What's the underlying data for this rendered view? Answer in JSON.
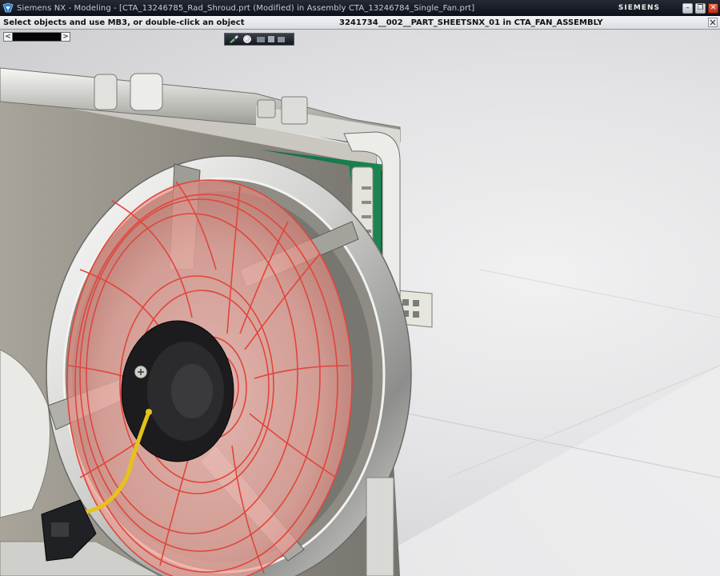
{
  "window": {
    "title": "Siemens NX - Modeling - [CTA_13246785_Rad_Shroud.prt (Modified)  in Assembly CTA_13246784_Single_Fan.prt]",
    "brand": "SIEMENS",
    "minimize_glyph": "–",
    "restore_glyph": "❐",
    "close_glyph": "✕"
  },
  "status_bar": {
    "prompt": "Select objects and use MB3, or double-click an object",
    "work_part": "3241734__002__PART_SHEETSNX_01 in CTA_FAN_ASSEMBLY"
  },
  "navigation": {
    "back_glyph": "<",
    "forward_glyph": ">"
  },
  "view_toolbar": {
    "tools": [
      "sketch-brush-icon",
      "render-sphere-icon",
      "view-orient-icon"
    ]
  },
  "colors": {
    "titlebar": "#1a1e27",
    "wireframe_highlight": "#e0463c",
    "circuit_board": "#16774a",
    "shroud_metal": "#d4d4d0",
    "fan_hub": "#1b1b1d",
    "wire_yellow": "#e6c21a"
  }
}
